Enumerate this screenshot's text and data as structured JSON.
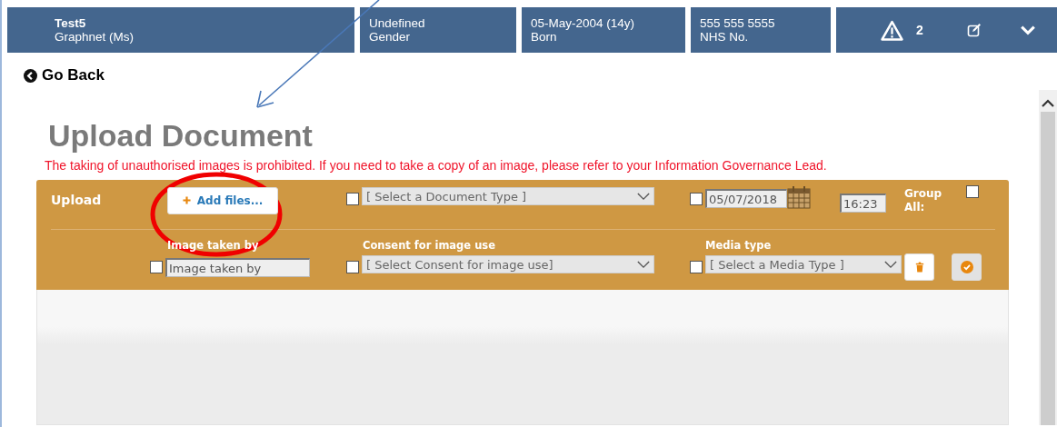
{
  "header": {
    "patient_name": "Test5",
    "patient_sub": "Graphnet (Ms)",
    "cells": [
      {
        "value": "Undefined",
        "label": "Gender"
      },
      {
        "value": "05-May-2004 (14y)",
        "label": "Born"
      },
      {
        "value": "555 555 5555",
        "label": "NHS No."
      }
    ],
    "alert_count": "2"
  },
  "go_back": "Go Back",
  "title": "Upload Document",
  "warning": "The taking of unauthorised images is prohibited. If you need to take a copy of an image, please refer to your Information Governance Lead.",
  "upload": {
    "label": "Upload",
    "add_files": "Add files...",
    "document_type": {
      "checked": false,
      "placeholder": "[ Select a Document Type ]"
    },
    "date": {
      "checked": false,
      "value": "05/07/2018"
    },
    "time": "16:23",
    "group_all": {
      "label": "Group All:",
      "checked": false
    },
    "image_taken_by": {
      "label": "Image taken by",
      "checked": false,
      "placeholder": "Image taken by"
    },
    "consent": {
      "label": "Consent for image use",
      "checked": false,
      "placeholder": "[ Select Consent for image use]"
    },
    "media_type": {
      "label": "Media type",
      "checked": false,
      "placeholder": "[ Select a Media Type ]"
    }
  }
}
